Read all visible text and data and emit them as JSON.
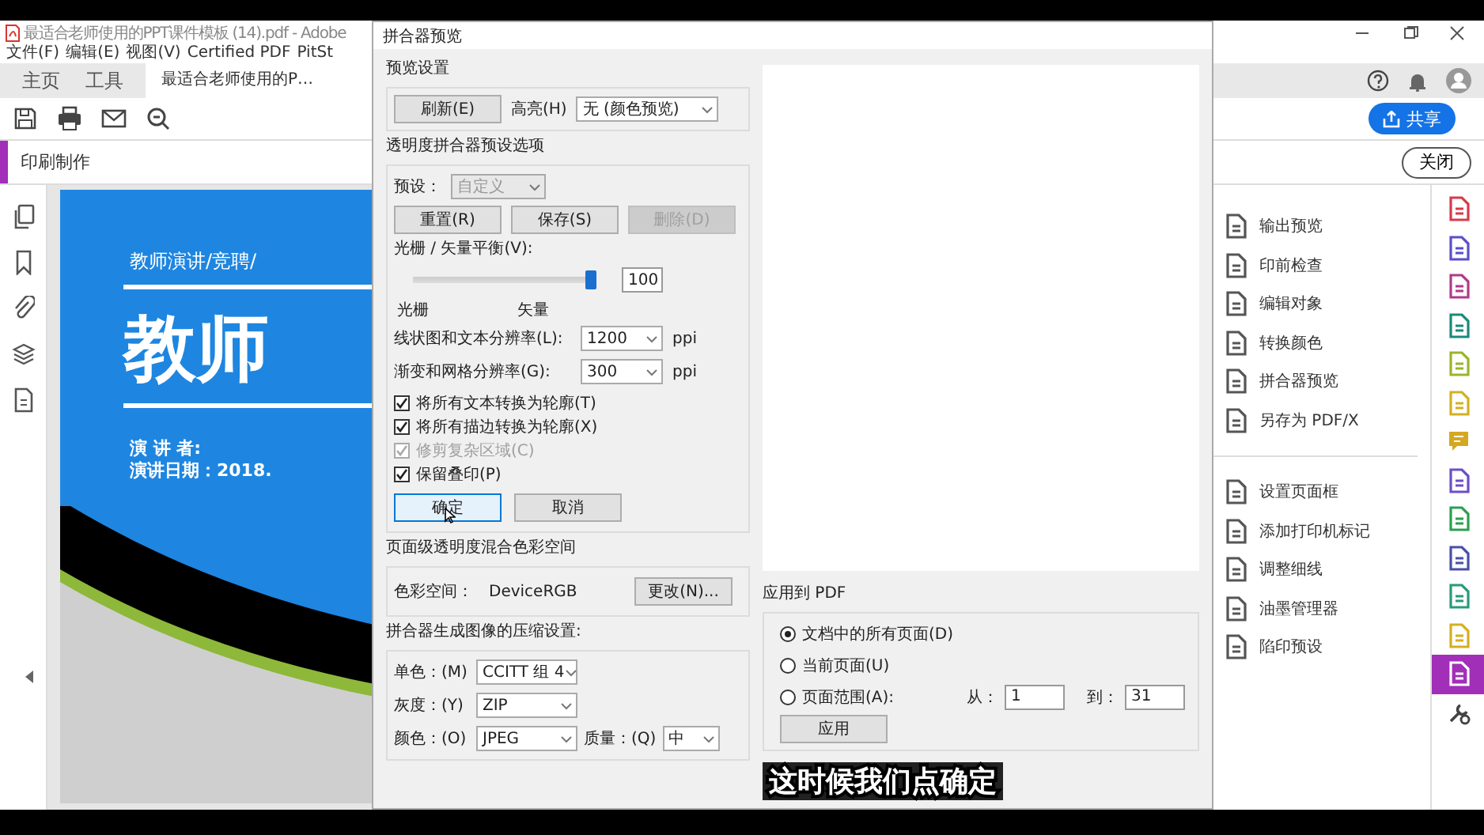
{
  "app": {
    "title": "最适合老师使用的PPT课件模板 (14).pdf - Adobe",
    "menu": [
      "文件(F)",
      "编辑(E)",
      "视图(V)",
      "Certified PDF",
      "PitSt"
    ],
    "tabs": [
      {
        "label": "主页",
        "selected": false
      },
      {
        "label": "工具",
        "selected": false
      },
      {
        "label": "最适合老师使用的P…",
        "selected": true
      }
    ],
    "share_button": "共享",
    "panel_title": "印刷制作",
    "close_button": "关闭",
    "slide": {
      "subtitle": "教师演讲/竞聘/",
      "title": "教师",
      "speaker": "演 讲 者:",
      "date": "演讲日期：2018."
    },
    "tool_groups": [
      [
        {
          "label": "输出预览"
        },
        {
          "label": "印前检查"
        },
        {
          "label": "编辑对象"
        },
        {
          "label": "转换颜色"
        },
        {
          "label": "拼合器预览"
        },
        {
          "label": "另存为 PDF/X"
        }
      ],
      [
        {
          "label": "设置页面框"
        },
        {
          "label": "添加打印机标记"
        },
        {
          "label": "调整细线"
        },
        {
          "label": "油墨管理器"
        },
        {
          "label": "陷印预设"
        }
      ]
    ],
    "tool_strip": [
      {
        "color": "#d83a4a",
        "selected": false,
        "kind": "page"
      },
      {
        "color": "#5b4fc8",
        "selected": false,
        "kind": "page"
      },
      {
        "color": "#b03a8a",
        "selected": false,
        "kind": "page"
      },
      {
        "color": "#1a8a7a",
        "selected": false,
        "kind": "page"
      },
      {
        "color": "#9ab52a",
        "selected": false,
        "kind": "page"
      },
      {
        "color": "#d4b020",
        "selected": false,
        "kind": "page"
      },
      {
        "color": "#d4a820",
        "selected": false,
        "kind": "comment"
      },
      {
        "color": "#6a4fc8",
        "selected": false,
        "kind": "page"
      },
      {
        "color": "#2aa050",
        "selected": false,
        "kind": "page"
      },
      {
        "color": "#4a4fa8",
        "selected": false,
        "kind": "page"
      },
      {
        "color": "#2a9a7a",
        "selected": false,
        "kind": "page"
      },
      {
        "color": "#d4b020",
        "selected": false,
        "kind": "page"
      },
      {
        "color": "#ffffff",
        "selected": true,
        "kind": "page"
      },
      {
        "color": "#444444",
        "selected": false,
        "kind": "tools"
      }
    ]
  },
  "dialog": {
    "title": "拼合器预览",
    "preview_settings": {
      "heading": "预览设置",
      "refresh_button": "刷新(E)",
      "highlight_label": "高亮(H)",
      "highlight_value": "无 (颜色预览)"
    },
    "preset_options": {
      "heading": "透明度拼合器预设选项",
      "preset_label": "预设：",
      "preset_value": "自定义",
      "preset_disabled": true,
      "buttons": [
        {
          "label": "重置(R)",
          "disabled": false
        },
        {
          "label": "保存(S)",
          "disabled": false
        },
        {
          "label": "删除(D)",
          "disabled": true
        }
      ],
      "balance_label": "光栅 / 矢量平衡(V):",
      "balance": {
        "level": 1,
        "reading": "100"
      },
      "scale_labels": [
        "光栅",
        "矢量"
      ],
      "resolutions": [
        {
          "label": "线状图和文本分辨率(L):",
          "value": "1200",
          "unit": "ppi"
        },
        {
          "label": "渐变和网格分辨率(G):",
          "value": "300",
          "unit": "ppi"
        }
      ],
      "checkboxes": [
        {
          "label": "将所有文本转换为轮廓(T)",
          "checked": true,
          "disabled": false
        },
        {
          "label": "将所有描边转换为轮廓(X)",
          "checked": true,
          "disabled": false
        },
        {
          "label": "修剪复杂区域(C)",
          "checked": true,
          "disabled": true
        },
        {
          "label": "保留叠印(P)",
          "checked": true,
          "disabled": false
        }
      ],
      "actions": [
        {
          "label": "确定",
          "default": true
        },
        {
          "label": "取消",
          "default": false
        }
      ]
    },
    "color_space": {
      "heading": "页面级透明度混合色彩空间",
      "label": "色彩空间：",
      "value": "DeviceRGB",
      "change_button": "更改(N)..."
    },
    "compression": {
      "heading": "拼合器生成图像的压缩设置:",
      "rows": [
        {
          "label": "单色：(M)",
          "value": "CCITT 组 4"
        },
        {
          "label": "灰度：(Y)",
          "value": "ZIP"
        },
        {
          "label": "颜色：(O)",
          "value": "JPEG",
          "quality_label": "质量：(Q)",
          "quality_value": "中"
        }
      ]
    },
    "apply": {
      "heading": "应用到 PDF",
      "options": [
        {
          "label": "文档中的所有页面(D)",
          "selected": true
        },
        {
          "label": "当前页面(U)",
          "selected": false
        },
        {
          "label": "页面范围(A):",
          "selected": false
        }
      ],
      "from_label": "从：",
      "from_value": "1",
      "to_label": "到：",
      "to_value": "31",
      "apply_button": "应用"
    }
  },
  "caption": "这时候我们点确定"
}
